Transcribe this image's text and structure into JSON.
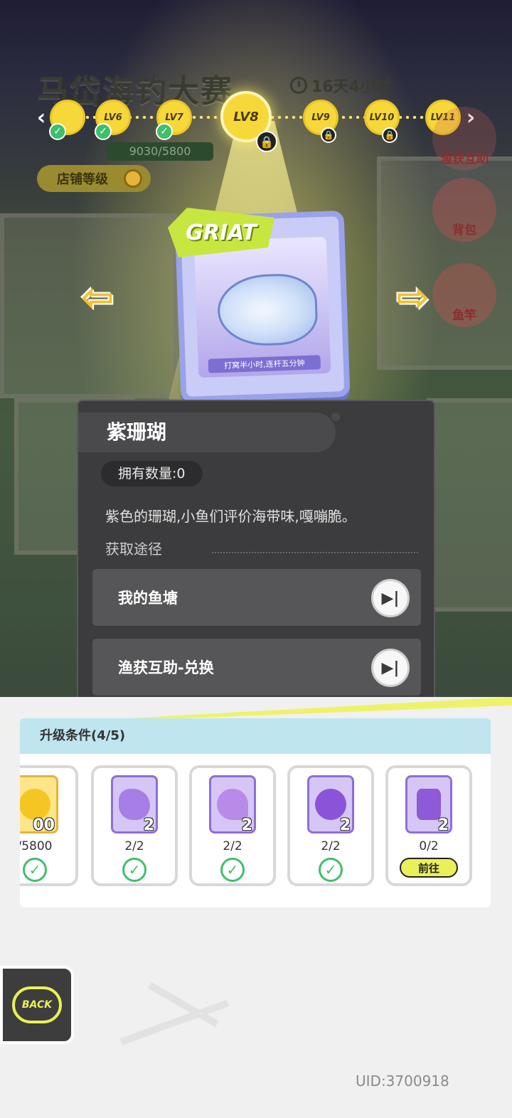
{
  "header": {
    "title": "马岱海钓大赛",
    "timer": "16天4小时",
    "shop_level_label": "店铺等级",
    "progress": "9030/5800"
  },
  "levels": [
    {
      "label": "",
      "state": "done"
    },
    {
      "label": "LV6",
      "state": "done"
    },
    {
      "label": "LV7",
      "state": "done"
    },
    {
      "label": "LV8",
      "state": "current"
    },
    {
      "label": "LV9",
      "state": "locked"
    },
    {
      "label": "LV10",
      "state": "locked"
    },
    {
      "label": "LV11",
      "state": "locked"
    }
  ],
  "side_buttons": {
    "assist": "渔获互助",
    "bag": "背包",
    "rod": "鱼竿"
  },
  "card": {
    "badge": "GRIAT",
    "caption": "打窝半小时,连杆五分钟"
  },
  "item": {
    "name": "紫珊瑚",
    "owned_label": "拥有数量:",
    "owned_value": "0",
    "description": "紫色的珊瑚,小鱼们评价海带味,嘎嘣脆。",
    "source_label": "获取途径",
    "sources": [
      {
        "label": "我的鱼塘"
      },
      {
        "label": "渔获互助-兑换"
      }
    ]
  },
  "upgrade": {
    "title": "升级条件(4/5)",
    "requirements": [
      {
        "count": "00",
        "value": "/5800",
        "status": "done"
      },
      {
        "count": "2",
        "value": "2/2",
        "status": "done"
      },
      {
        "count": "2",
        "value": "2/2",
        "status": "done"
      },
      {
        "count": "2",
        "value": "2/2",
        "status": "done"
      },
      {
        "count": "2",
        "value": "0/2",
        "status": "goto",
        "action_label": "前往"
      }
    ]
  },
  "back_label": "BACK",
  "uid": "UID:3700918",
  "colors": {
    "accent": "#e9f058",
    "success": "#3fbf6a",
    "panel": "#3c3c3e"
  }
}
